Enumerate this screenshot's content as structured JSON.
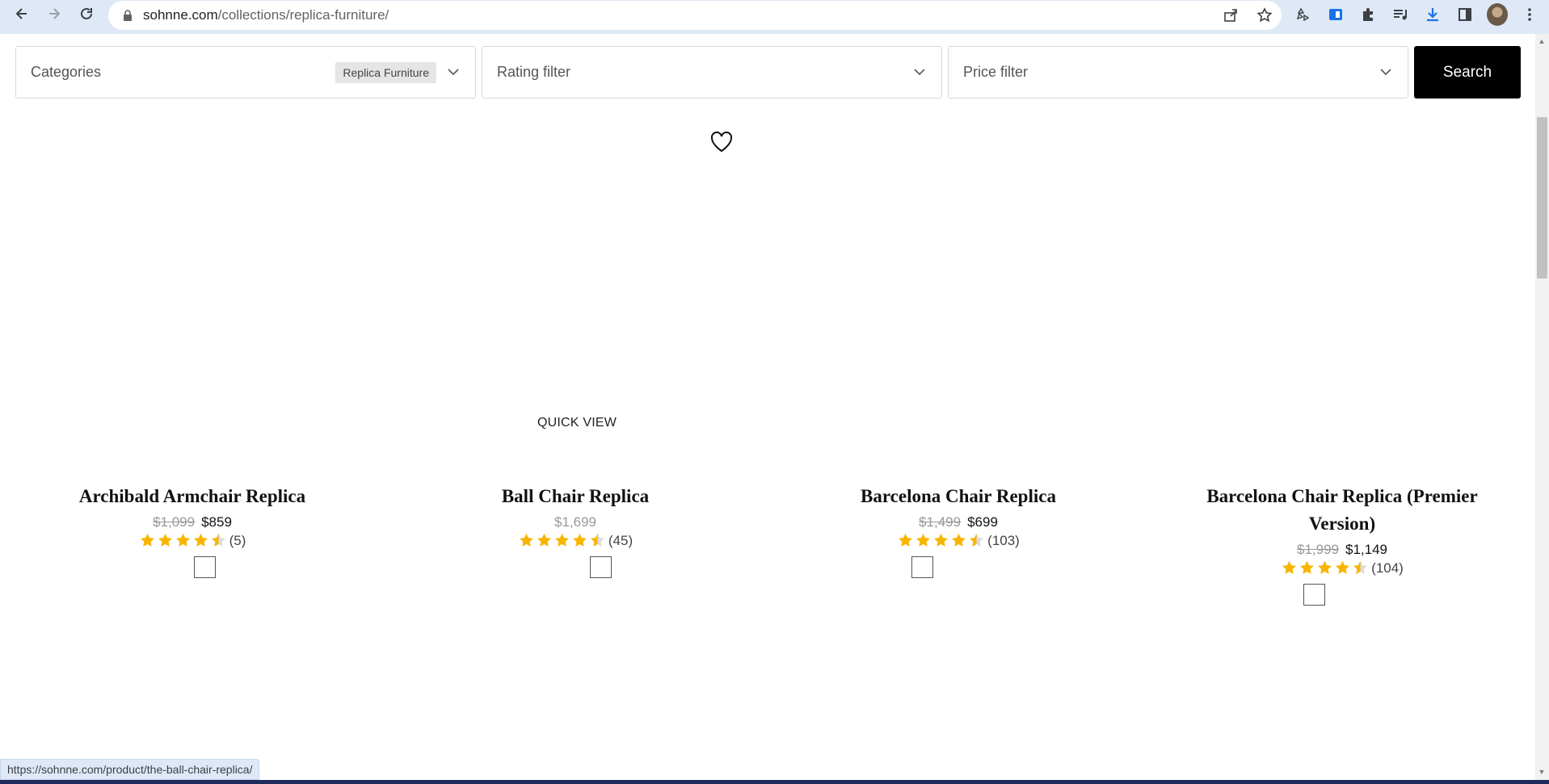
{
  "browser": {
    "url_host": "sohnne.com",
    "url_path": "/collections/replica-furniture/",
    "status_url": "https://sohnne.com/product/the-ball-chair-replica/"
  },
  "filters": {
    "categories_label": "Categories",
    "categories_tag": "Replica Furniture",
    "rating_label": "Rating filter",
    "price_label": "Price filter",
    "search_label": "Search"
  },
  "quick_view": "QUICK VIEW",
  "products": [
    {
      "title": "Archibald Armchair Replica",
      "old_price": "$1,099",
      "price": "$859",
      "rating": 4.5,
      "reviews": "(5)"
    },
    {
      "title": "Ball Chair Replica",
      "old_price": "",
      "price": "$1,699",
      "rating": 4.5,
      "reviews": "(45)"
    },
    {
      "title": "Barcelona Chair Replica",
      "old_price": "$1,499",
      "price": "$699",
      "rating": 4.5,
      "reviews": "(103)"
    },
    {
      "title": "Barcelona Chair Replica (Premier Version)",
      "old_price": "$1,999",
      "price": "$1,149",
      "rating": 4.5,
      "reviews": "(104)"
    }
  ],
  "colors": {
    "star": "#f7b500",
    "star_empty": "#dcdcdc",
    "search_bg": "#000000",
    "chrome_bg": "#dfe8f7"
  }
}
